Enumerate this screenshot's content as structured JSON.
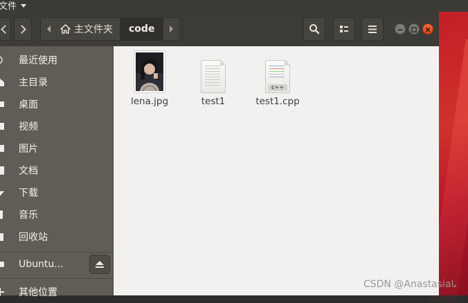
{
  "topbar": {
    "app_menu": "文件"
  },
  "window": {
    "path": {
      "home": "主文件夹",
      "current": "code"
    }
  },
  "sidebar": {
    "items": [
      {
        "label": "最近使用",
        "icon": "clock-icon"
      },
      {
        "label": "主目录",
        "icon": "home-icon"
      },
      {
        "label": "桌面",
        "icon": "desktop-icon"
      },
      {
        "label": "视频",
        "icon": "video-icon"
      },
      {
        "label": "图片",
        "icon": "picture-icon"
      },
      {
        "label": "文档",
        "icon": "document-icon"
      },
      {
        "label": "下载",
        "icon": "download-icon"
      },
      {
        "label": "音乐",
        "icon": "music-icon"
      },
      {
        "label": "回收站",
        "icon": "trash-icon"
      }
    ],
    "devices": [
      {
        "label": "Ubuntu...",
        "icon": "disk-icon"
      }
    ],
    "other": {
      "label": "其他位置",
      "icon": "plus-icon"
    }
  },
  "files": [
    {
      "name": "lena.jpg",
      "type": "image"
    },
    {
      "name": "test1",
      "type": "text"
    },
    {
      "name": "test1.cpp",
      "type": "cpp",
      "badge": "c++"
    }
  ],
  "watermark": "CSDN @Anastasia𑀧"
}
